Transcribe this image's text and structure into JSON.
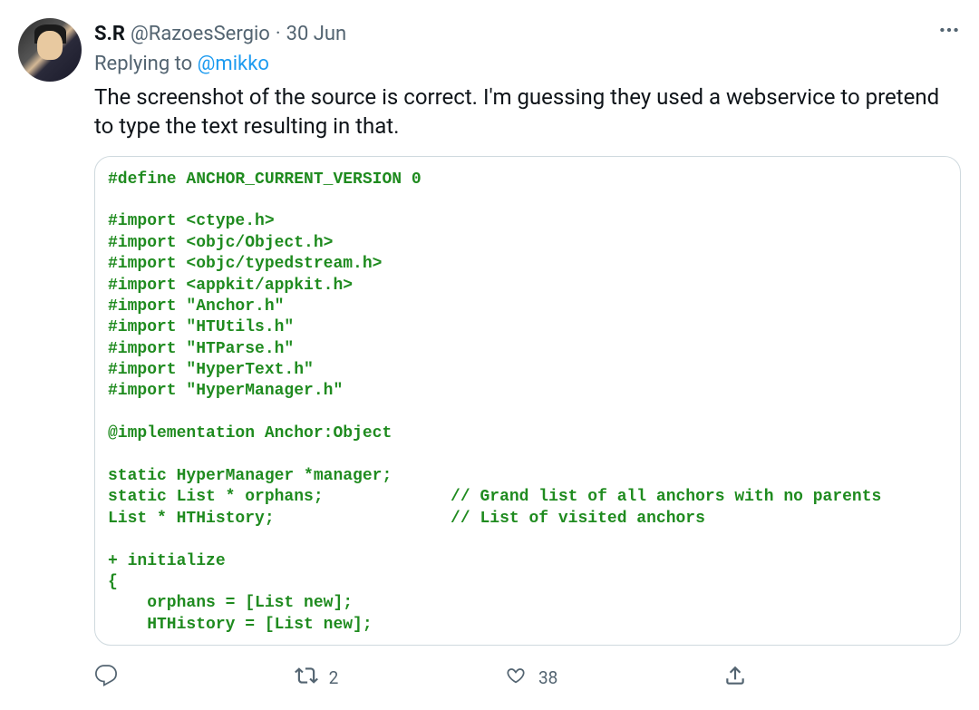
{
  "tweet": {
    "display_name": "S.R",
    "handle": "@RazoesSergio",
    "dot": "·",
    "date": "30 Jun",
    "replying_prefix": "Replying to ",
    "replying_to": "@mikko",
    "body": "The screenshot of the source is correct. I'm guessing they used a webservice to pretend to type the text resulting in that.",
    "code": "#define ANCHOR_CURRENT_VERSION 0\n\n#import <ctype.h>\n#import <objc/Object.h>\n#import <objc/typedstream.h>\n#import <appkit/appkit.h>\n#import \"Anchor.h\"\n#import \"HTUtils.h\"\n#import \"HTParse.h\"\n#import \"HyperText.h\"\n#import \"HyperManager.h\"\n\n@implementation Anchor:Object\n\nstatic HyperManager *manager;\nstatic List * orphans;             // Grand list of all anchors with no parents\nList * HTHistory;                  // List of visited anchors\n\n+ initialize\n{\n    orphans = [List new];\n    HTHistory = [List new];"
  },
  "actions": {
    "reply_count": "",
    "retweet_count": "2",
    "like_count": "38"
  }
}
